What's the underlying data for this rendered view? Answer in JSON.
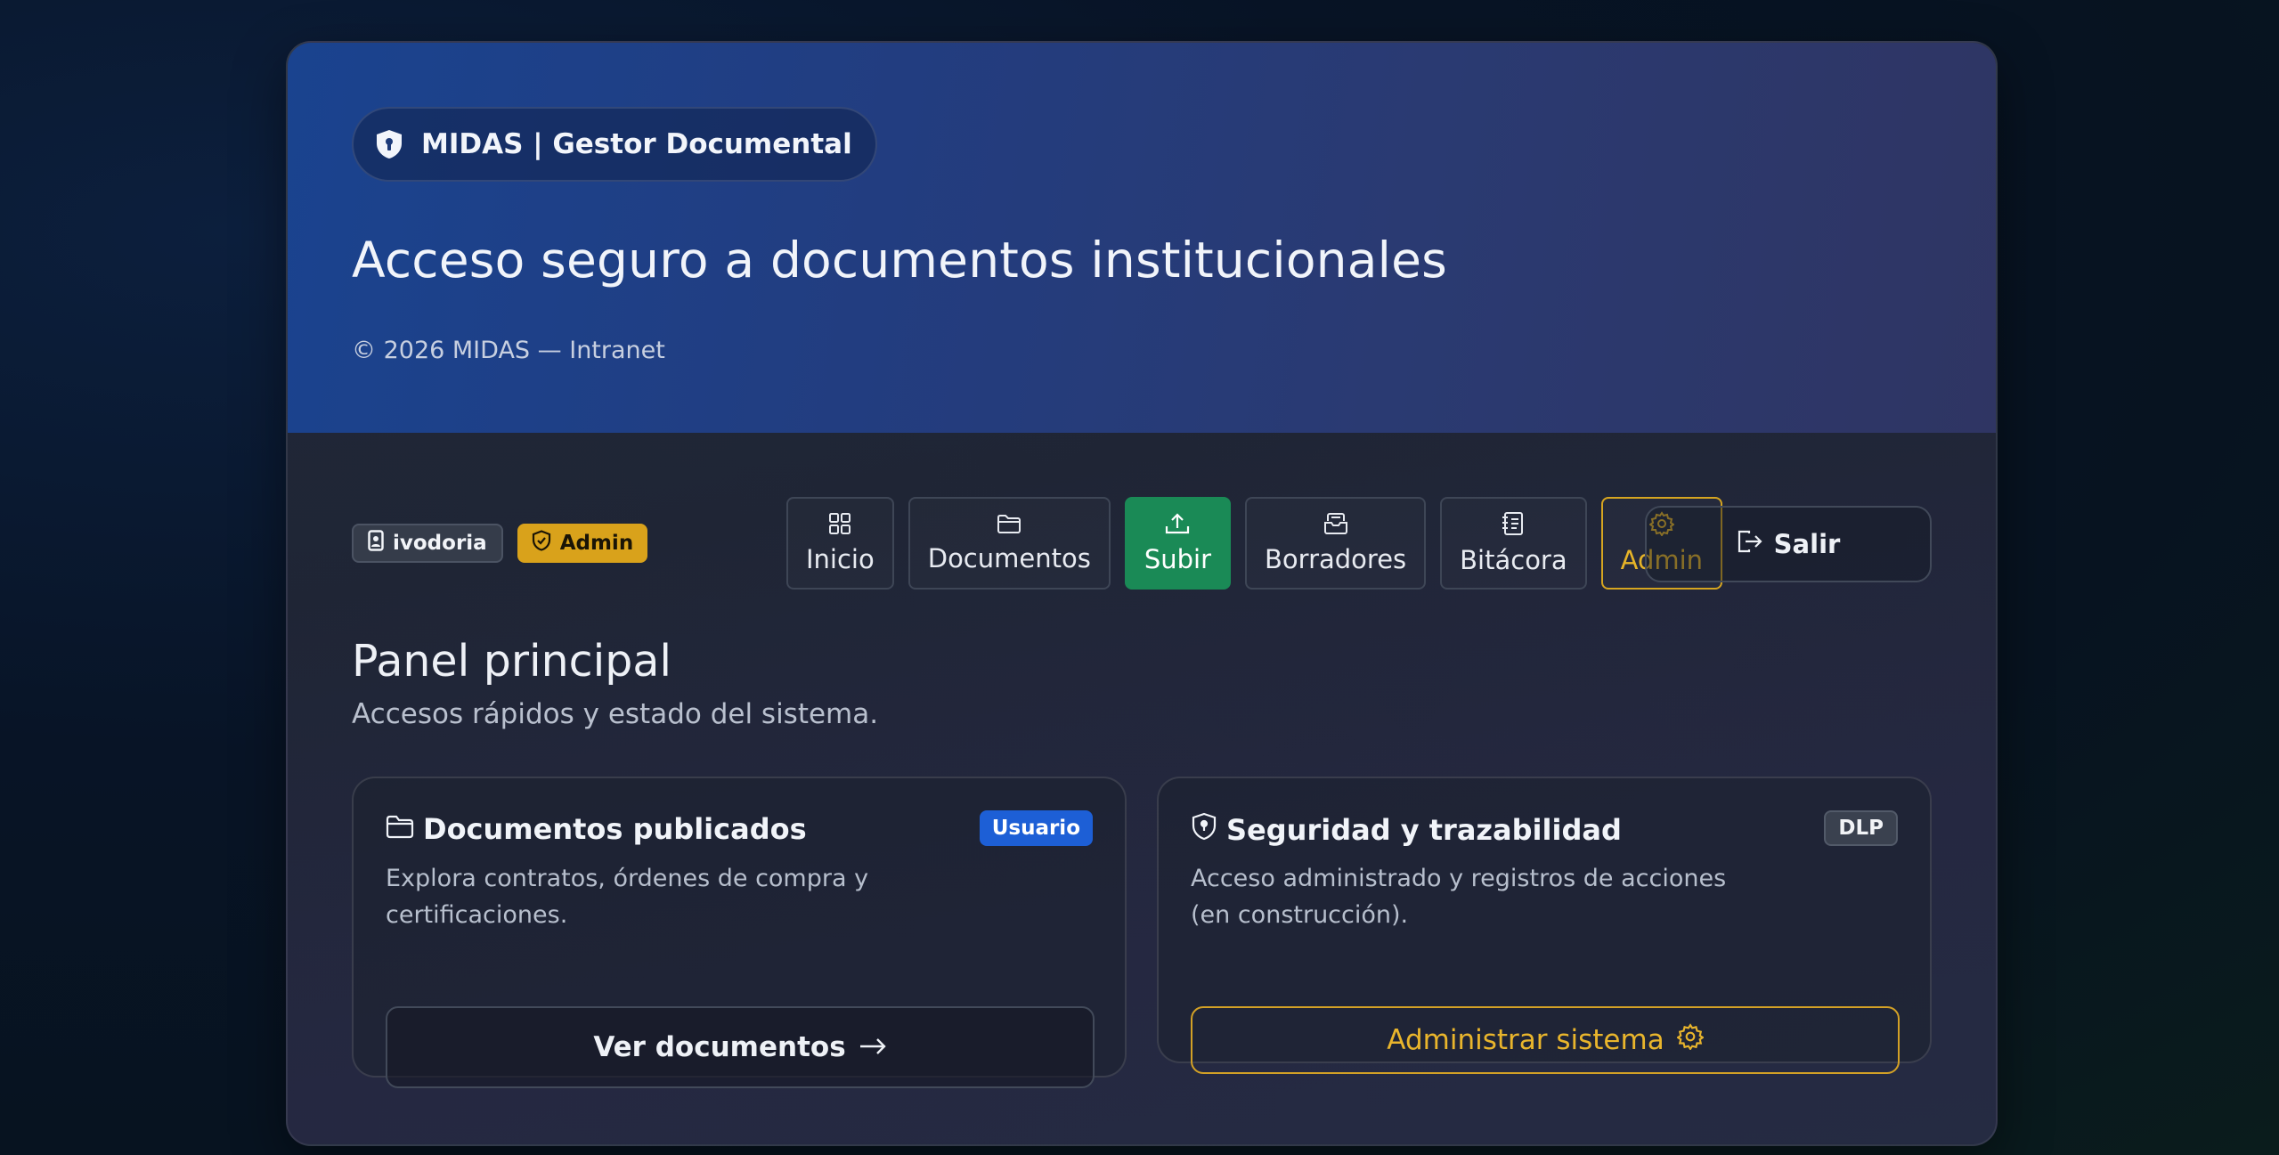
{
  "header": {
    "brand": "MIDAS | Gestor Documental",
    "title": "Acceso seguro a documentos institucionales",
    "copyright": "© 2026 MIDAS — Intranet"
  },
  "user": {
    "username": "ivodoria",
    "role": "Admin"
  },
  "nav": {
    "items": [
      {
        "label": "Inicio",
        "icon": "grid-icon"
      },
      {
        "label": "Documentos",
        "icon": "folder-icon"
      },
      {
        "label": "Subir",
        "icon": "upload-icon",
        "active": true
      },
      {
        "label": "Borradores",
        "icon": "archive-icon"
      },
      {
        "label": "Bitácora",
        "icon": "journal-icon"
      },
      {
        "label": "Admin",
        "icon": "gear-icon"
      }
    ],
    "logout": "Salir"
  },
  "main": {
    "title": "Panel principal",
    "subtitle": "Accesos rápidos y estado del sistema.",
    "cards": [
      {
        "title": "Documentos publicados",
        "badge": "Usuario",
        "description": "Explora contratos, órdenes de compra y certificaciones.",
        "button": "Ver documentos",
        "icon": "folder-icon"
      },
      {
        "title": "Seguridad y trazabilidad",
        "badge": "DLP",
        "description": "Acceso administrado y registros de acciones (en construcción).",
        "button": "Administrar sistema",
        "icon": "shield-icon"
      }
    ]
  },
  "colors": {
    "accent_green": "#1a8a56",
    "accent_yellow": "#d9a21b",
    "accent_blue": "#1d5fd6"
  }
}
